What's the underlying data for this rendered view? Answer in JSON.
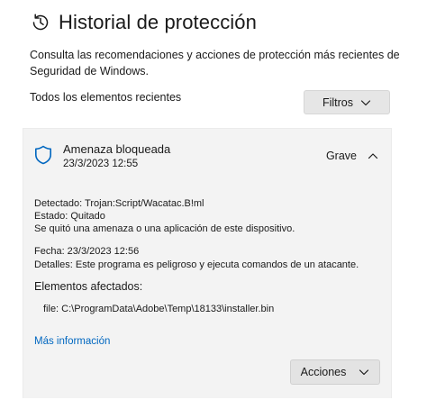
{
  "header": {
    "title": "Historial de protección",
    "description": "Consulta las recomendaciones y acciones de protección más recientes de Seguridad de Windows."
  },
  "toolbar": {
    "section_label": "Todos los elementos recientes",
    "filters_label": "Filtros"
  },
  "threat": {
    "title": "Amenaza bloqueada",
    "date": "23/3/2023 12:55",
    "severity": "Grave",
    "detected": "Detectado:  Trojan:Script/Wacatac.B!ml",
    "status": "Estado:  Quitado",
    "status_desc": "Se quitó una amenaza o una aplicación de este dispositivo.",
    "date_line": "Fecha:  23/3/2023 12:56",
    "details": "Detalles:  Este programa es peligroso y ejecuta comandos de un atacante.",
    "affected_title": "Elementos afectados:",
    "file": "file:  C:\\ProgramData\\Adobe\\Temp\\18133\\installer.bin",
    "more_info": "Más información",
    "actions_label": "Acciones"
  },
  "colors": {
    "accent_link": "#0067c0",
    "shield": "#0067c0",
    "card_bg": "#f3f3f3"
  }
}
